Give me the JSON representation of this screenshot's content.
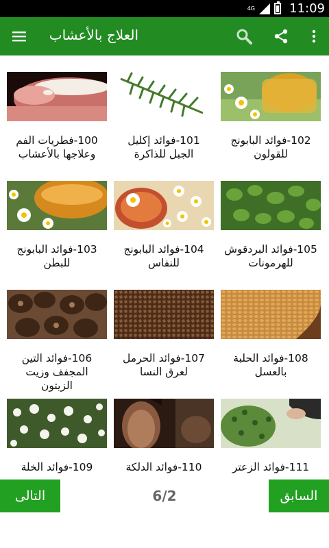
{
  "status": {
    "network": "4G",
    "time": "11:09",
    "battery_level": 0.9
  },
  "appbar": {
    "title": "العلاج بالأعشاب",
    "icons": {
      "menu": "hamburger-menu-icon",
      "search": "search-icon",
      "share": "share-icon",
      "more": "more-vertical-icon"
    }
  },
  "colors": {
    "appbar": "#228b22",
    "nav_button": "#22a022",
    "page_text": "#666666"
  },
  "items": [
    {
      "caption": "100-فطريات الفم وعلاجها بالأعشاب",
      "image": "mouth-sore"
    },
    {
      "caption": "101-فوائد إكليل الجبل للذاكرة",
      "image": "rosemary"
    },
    {
      "caption": "102-فوائد البابونج للقولون",
      "image": "chamomile-tea"
    },
    {
      "caption": "103-فوائد البابونج للبطن",
      "image": "chamomile-tea-2"
    },
    {
      "caption": "104-فوائد البابونج للنفاس",
      "image": "chamomile-cup"
    },
    {
      "caption": "105-فوائد البردقوش للهرمونات",
      "image": "marjoram"
    },
    {
      "caption": "106-فوائد التين المجفف وزيت الزيتون",
      "image": "dried-figs"
    },
    {
      "caption": "107-فوائد الحرمل لعرق النسا",
      "image": "harmal-seeds"
    },
    {
      "caption": "108-فوائد الحلبة بالعسل",
      "image": "fenugreek"
    },
    {
      "caption": "109-فوائد الخلة",
      "image": "khella-flowers"
    },
    {
      "caption": "110-فوائد الدلكة",
      "image": "face-mask"
    },
    {
      "caption": "111-فوائد الزعتر",
      "image": "thyme"
    }
  ],
  "footer": {
    "next_label": "التالى",
    "page": "6/2",
    "prev_label": "السابق"
  }
}
